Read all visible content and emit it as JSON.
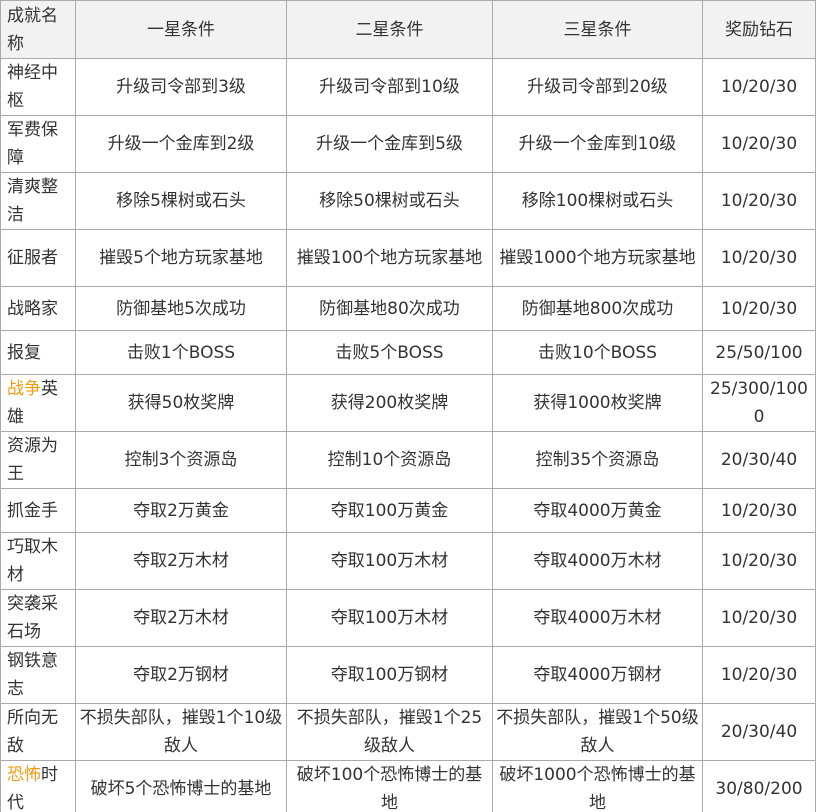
{
  "headers": [
    "成就名称",
    "一星条件",
    "二星条件",
    "三星条件",
    "奖励钻石"
  ],
  "rows": [
    {
      "name": "神经中枢",
      "hl": "",
      "c1": "升级司令部到3级",
      "c2": "升级司令部到10级",
      "c3": "升级司令部到20级",
      "reward": "10/20/30"
    },
    {
      "name": "军费保障",
      "hl": "",
      "c1": "升级一个金库到2级",
      "c2": "升级一个金库到5级",
      "c3": "升级一个金库到10级",
      "reward": "10/20/30"
    },
    {
      "name": "清爽整洁",
      "hl": "",
      "c1": "移除5棵树或石头",
      "c2": "移除50棵树或石头",
      "c3": "移除100棵树或石头",
      "reward": "10/20/30"
    },
    {
      "name": "征服者",
      "hl": "",
      "c1": "摧毁5个地方玩家基地",
      "c2": "摧毁100个地方玩家基地",
      "c3": "摧毁1000个地方玩家基地",
      "reward": "10/20/30"
    },
    {
      "name": "战略家",
      "hl": "",
      "c1": "防御基地5次成功",
      "c2": "防御基地80次成功",
      "c3": "防御基地800次成功",
      "reward": "10/20/30"
    },
    {
      "name": "报复",
      "hl": "",
      "c1": "击败1个BOSS",
      "c2": "击败5个BOSS",
      "c3": "击败10个BOSS",
      "reward": "25/50/100"
    },
    {
      "name": "英雄",
      "hl": "战争",
      "c1": "获得50枚奖牌",
      "c2": "获得200枚奖牌",
      "c3": "获得1000枚奖牌",
      "reward": "25/300/1000"
    },
    {
      "name": "资源为王",
      "hl": "",
      "c1": "控制3个资源岛",
      "c2": "控制10个资源岛",
      "c3": "控制35个资源岛",
      "reward": "20/30/40"
    },
    {
      "name": "抓金手",
      "hl": "",
      "c1": "夺取2万黄金",
      "c2": "夺取100万黄金",
      "c3": "夺取4000万黄金",
      "reward": "10/20/30"
    },
    {
      "name": "巧取木材",
      "hl": "",
      "c1": "夺取2万木材",
      "c2": "夺取100万木材",
      "c3": "夺取4000万木材",
      "reward": "10/20/30"
    },
    {
      "name": "突袭采石场",
      "hl": "",
      "c1": "夺取2万木材",
      "c2": "夺取100万木材",
      "c3": "夺取4000万木材",
      "reward": "10/20/30"
    },
    {
      "name": "钢铁意志",
      "hl": "",
      "c1": "夺取2万钢材",
      "c2": "夺取100万钢材",
      "c3": "夺取4000万钢材",
      "reward": "10/20/30"
    },
    {
      "name": "所向无敌",
      "hl": "",
      "c1": "不损失部队，摧毁1个10级敌人",
      "c2": "不损失部队，摧毁1个25级敌人",
      "c3": "不损失部队，摧毁1个50级敌人",
      "reward": "20/30/40"
    },
    {
      "name": "时代",
      "hl": "恐怖",
      "c1": "破坏5个恐怖博士的基地",
      "c2": "破坏100个恐怖博士的基地",
      "c3": "破坏1000个恐怖博士的基地",
      "reward": "30/80/200"
    }
  ]
}
